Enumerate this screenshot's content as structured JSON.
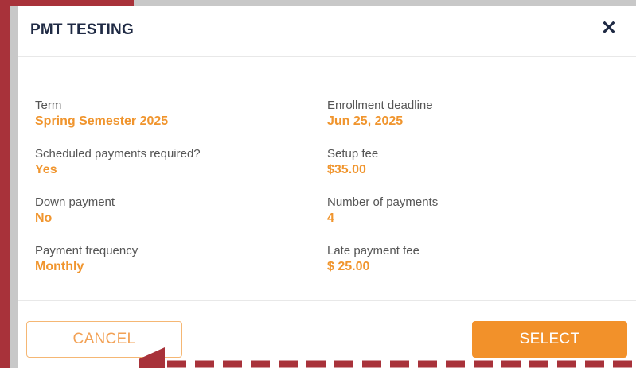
{
  "modal": {
    "title": "PMT TESTING",
    "close_glyph": "✕"
  },
  "details": {
    "left": [
      {
        "label": "Term",
        "value": "Spring Semester 2025"
      },
      {
        "label": "Scheduled payments required?",
        "value": "Yes"
      },
      {
        "label": "Down payment",
        "value": "No"
      },
      {
        "label": "Payment frequency",
        "value": "Monthly"
      }
    ],
    "right": [
      {
        "label": "Enrollment deadline",
        "value": "Jun 25, 2025"
      },
      {
        "label": "Setup fee",
        "value": "$35.00"
      },
      {
        "label": "Number of payments",
        "value": "4"
      },
      {
        "label": "Late payment fee",
        "value": "$ 25.00"
      }
    ]
  },
  "buttons": {
    "cancel_label": "CANCEL",
    "select_label": "SELECT"
  },
  "colors": {
    "accent": "#f2912a",
    "annotation": "#a8323a",
    "title": "#1f2a44"
  },
  "icons": {
    "close": "close-icon"
  }
}
